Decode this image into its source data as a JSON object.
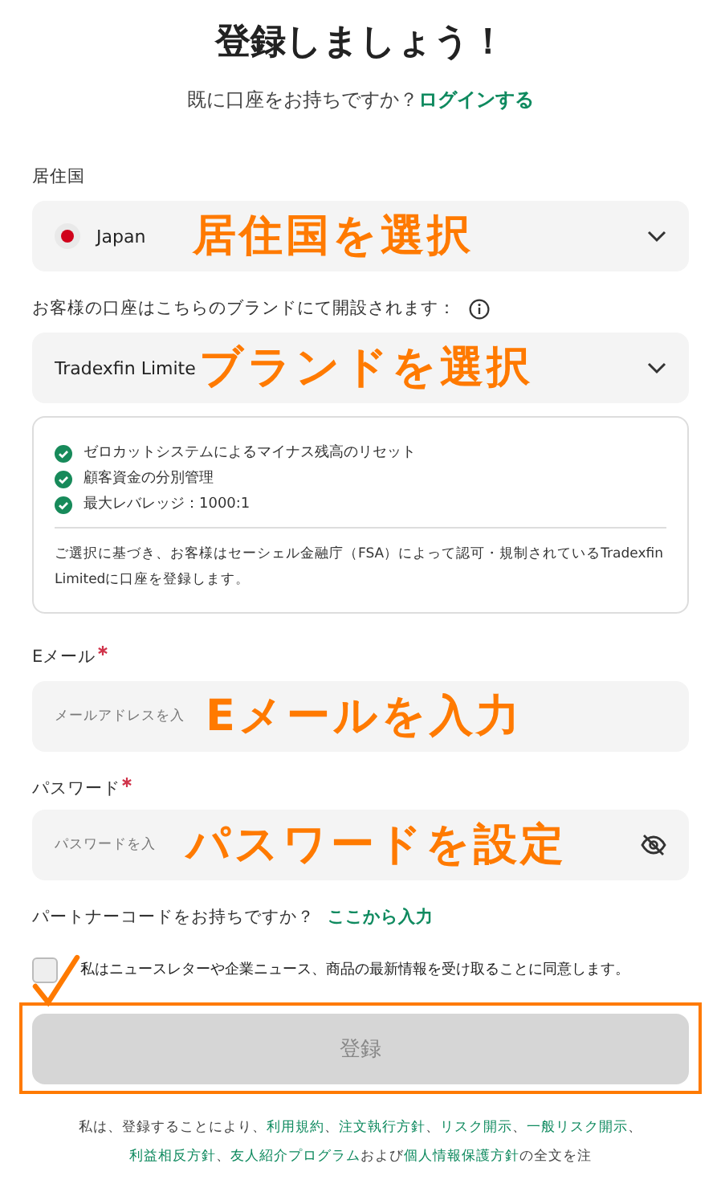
{
  "title": "登録しましょう！",
  "subtitle": {
    "text": "既に口座をお持ちですか？",
    "link": "ログインする"
  },
  "country": {
    "label": "居住国",
    "value": "Japan",
    "annotation": "居住国を選択"
  },
  "brand": {
    "label": "お客様の口座はこちらのブランドにて開設されます：",
    "value": "Tradexfin Limite",
    "annotation": "ブランドを選択"
  },
  "features": [
    "ゼロカットシステムによるマイナス残高のリセット",
    "顧客資金の分別管理",
    "最大レバレッジ：1000:1"
  ],
  "brand_note": "ご選択に基づき、お客様はセーシェル金融庁（FSA）によって認可・規制されているTradexfin Limitedに口座を登録します。",
  "email": {
    "label": "Eメール",
    "required": true,
    "placeholder": "メールアドレスを入",
    "annotation": "Eメールを入力"
  },
  "password": {
    "label": "パスワード",
    "required": true,
    "placeholder": "パスワードを入",
    "annotation": "パスワードを設定"
  },
  "partner": {
    "text": "パートナーコードをお持ちですか？",
    "link": "ここから入力"
  },
  "newsletter": {
    "label": "私はニュースレターや企業ニュース、商品の最新情報を受け取ることに同意します。",
    "checked": false,
    "annotated": true
  },
  "submit": {
    "label": "登録",
    "disabled": true,
    "highlighted": true
  },
  "footer": [
    {
      "kind": "text",
      "text": "私は、登録することにより、"
    },
    {
      "kind": "link",
      "text": "利用規約"
    },
    {
      "kind": "text",
      "text": "、"
    },
    {
      "kind": "link",
      "text": "注文執行方針"
    },
    {
      "kind": "text",
      "text": "、"
    },
    {
      "kind": "link",
      "text": "リスク開示"
    },
    {
      "kind": "text",
      "text": "、"
    },
    {
      "kind": "link",
      "text": "一般リスク開示"
    },
    {
      "kind": "text",
      "text": "、"
    },
    {
      "kind": "link",
      "text": "利益相反方針"
    },
    {
      "kind": "text",
      "text": "、"
    },
    {
      "kind": "link",
      "text": "友人紹介プログラム"
    },
    {
      "kind": "text",
      "text": "および"
    },
    {
      "kind": "link",
      "text": "個人情報保護方針"
    },
    {
      "kind": "text",
      "text": "の全文を注"
    }
  ]
}
